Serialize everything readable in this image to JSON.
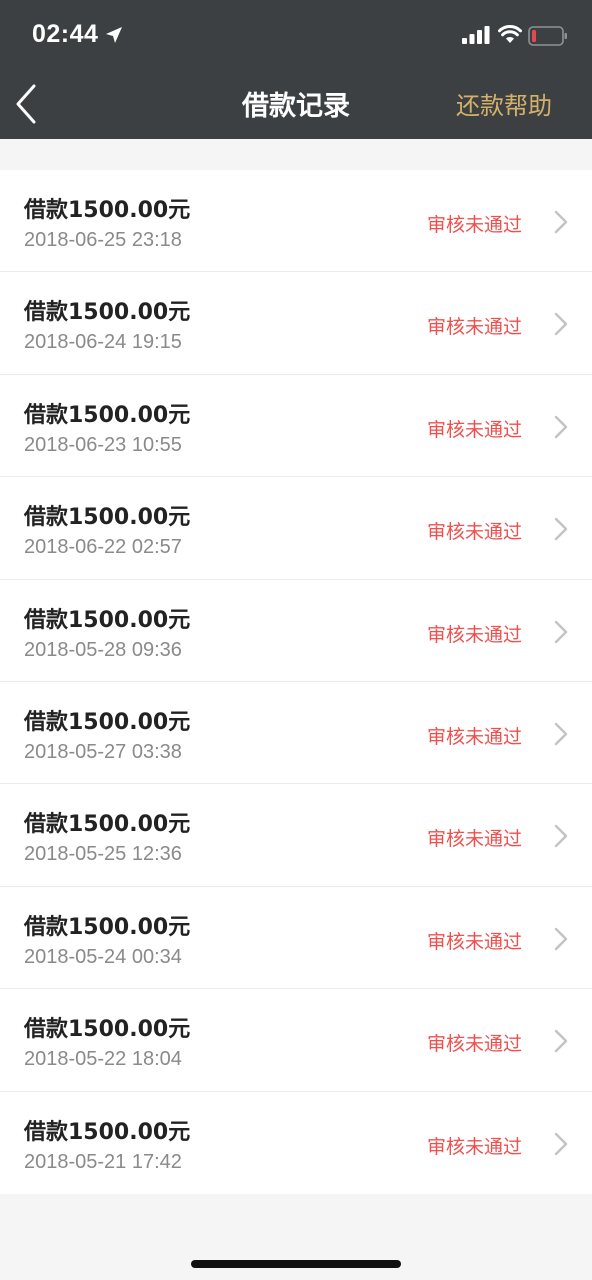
{
  "status_bar": {
    "time": "02:44",
    "icons": [
      "location-arrow-icon",
      "signal-icon",
      "wifi-icon",
      "battery-icon"
    ]
  },
  "nav": {
    "title": "借款记录",
    "back_icon": "chevron-left-icon",
    "help_label": "还款帮助"
  },
  "colors": {
    "header_bg": "#3d4043",
    "accent_gold": "#d4b16a",
    "status_red": "#f0504d",
    "battery_low": "#e5484d"
  },
  "records": [
    {
      "amount": "借款1500.00元",
      "date": "2018-06-25 23:18",
      "status": "审核未通过"
    },
    {
      "amount": "借款1500.00元",
      "date": "2018-06-24 19:15",
      "status": "审核未通过"
    },
    {
      "amount": "借款1500.00元",
      "date": "2018-06-23 10:55",
      "status": "审核未通过"
    },
    {
      "amount": "借款1500.00元",
      "date": "2018-06-22 02:57",
      "status": "审核未通过"
    },
    {
      "amount": "借款1500.00元",
      "date": "2018-05-28 09:36",
      "status": "审核未通过"
    },
    {
      "amount": "借款1500.00元",
      "date": "2018-05-27 03:38",
      "status": "审核未通过"
    },
    {
      "amount": "借款1500.00元",
      "date": "2018-05-25 12:36",
      "status": "审核未通过"
    },
    {
      "amount": "借款1500.00元",
      "date": "2018-05-24 00:34",
      "status": "审核未通过"
    },
    {
      "amount": "借款1500.00元",
      "date": "2018-05-22 18:04",
      "status": "审核未通过"
    },
    {
      "amount": "借款1500.00元",
      "date": "2018-05-21 17:42",
      "status": "审核未通过"
    }
  ]
}
